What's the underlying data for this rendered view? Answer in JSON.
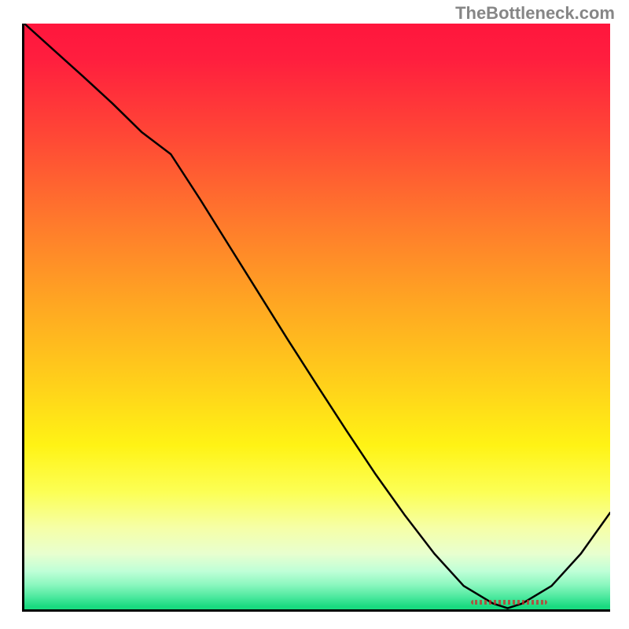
{
  "watermark": "TheBottleneck.com",
  "chart_data": {
    "type": "line",
    "title": "",
    "xlabel": "",
    "ylabel": "",
    "x": [
      0.0,
      0.05,
      0.1,
      0.15,
      0.2,
      0.25,
      0.3,
      0.35,
      0.4,
      0.45,
      0.5,
      0.55,
      0.6,
      0.65,
      0.7,
      0.75,
      0.8,
      0.825,
      0.85,
      0.9,
      0.95,
      1.0
    ],
    "values": [
      1.0,
      0.955,
      0.91,
      0.864,
      0.815,
      0.777,
      0.7,
      0.62,
      0.54,
      0.46,
      0.382,
      0.305,
      0.23,
      0.16,
      0.095,
      0.04,
      0.01,
      0.002,
      0.01,
      0.04,
      0.095,
      0.165
    ],
    "xlim": [
      0,
      1
    ],
    "ylim": [
      0,
      1
    ],
    "optimal_range_x": [
      0.76,
      0.89
    ],
    "gradient_stops": [
      {
        "offset": 0.0,
        "color": "#ff163d"
      },
      {
        "offset": 0.06,
        "color": "#ff1e3e"
      },
      {
        "offset": 0.2,
        "color": "#ff4a35"
      },
      {
        "offset": 0.34,
        "color": "#ff7a2c"
      },
      {
        "offset": 0.48,
        "color": "#ffa722"
      },
      {
        "offset": 0.62,
        "color": "#ffd21a"
      },
      {
        "offset": 0.72,
        "color": "#fff315"
      },
      {
        "offset": 0.8,
        "color": "#fcff55"
      },
      {
        "offset": 0.86,
        "color": "#f6ffa6"
      },
      {
        "offset": 0.905,
        "color": "#e8ffcf"
      },
      {
        "offset": 0.935,
        "color": "#bfffd7"
      },
      {
        "offset": 0.958,
        "color": "#8bf7bf"
      },
      {
        "offset": 0.978,
        "color": "#4fe9a0"
      },
      {
        "offset": 0.995,
        "color": "#1ada80"
      }
    ]
  }
}
